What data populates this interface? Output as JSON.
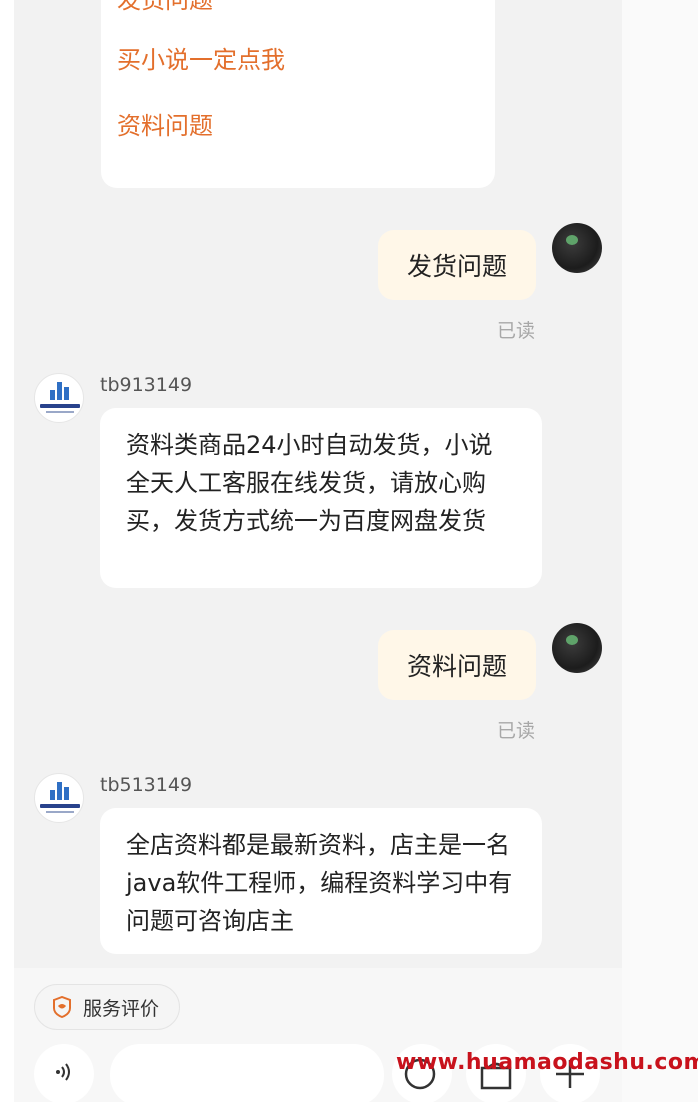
{
  "menu": {
    "items": [
      "发货问题",
      "买小说一定点我",
      "资料问题"
    ]
  },
  "messages": [
    {
      "type": "outgoing",
      "text": "发货问题",
      "status": "已读"
    },
    {
      "type": "incoming",
      "sender": "tb913149",
      "text": "资料类商品24小时自动发货，小说全天人工客服在线发货，请放心购买，发货方式统一为百度网盘发货"
    },
    {
      "type": "outgoing",
      "text": "资料问题",
      "status": "已读"
    },
    {
      "type": "incoming",
      "sender": "tb513149",
      "text": "全店资料都是最新资料，店主是一名java软件工程师，编程资料学习中有问题可咨询店主"
    }
  ],
  "bottom": {
    "eval_label": "服务评价",
    "input_placeholder": ""
  },
  "watermark": "www.huamaodashu.com",
  "colors": {
    "accent": "#e36f2c",
    "outgoing_bubble": "#fff7e8",
    "watermark": "#c8121c"
  },
  "icons": {
    "eval": "flower-shield-icon",
    "voice": "voice-icon",
    "emoji": "emoji-icon",
    "shop": "shop-icon",
    "plus": "plus-icon"
  }
}
